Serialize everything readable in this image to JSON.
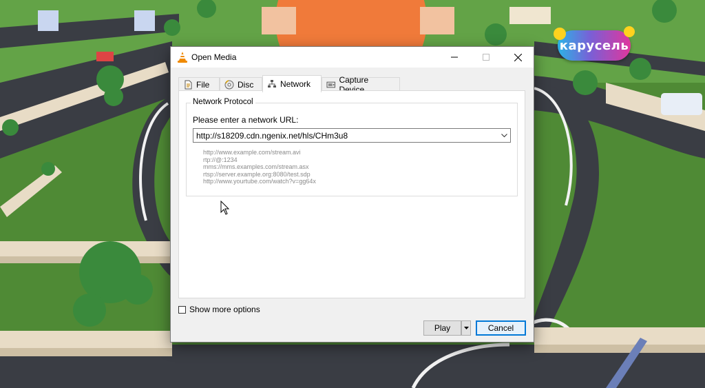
{
  "background": {
    "logo_text": "карусель"
  },
  "dialog": {
    "title": "Open Media",
    "window_buttons": {
      "minimize": "minimize-icon",
      "maximize": "maximize-icon",
      "close": "close-icon"
    },
    "tabs": [
      {
        "label": "File",
        "icon": "file-icon",
        "active": false
      },
      {
        "label": "Disc",
        "icon": "disc-icon",
        "active": false
      },
      {
        "label": "Network",
        "icon": "network-icon",
        "active": true
      },
      {
        "label": "Capture Device",
        "icon": "capture-device-icon",
        "active": false
      }
    ],
    "network": {
      "group_title": "Network Protocol",
      "url_label": "Please enter a network URL:",
      "url_value": "http://s18209.cdn.ngenix.net/hls/CHm3u8",
      "examples": [
        "http://www.example.com/stream.avi",
        "rtp://@:1234",
        "mms://mms.examples.com/stream.asx",
        "rtsp://server.example.org:8080/test.sdp",
        "http://www.yourtube.com/watch?v=gg64x"
      ]
    },
    "show_more_options": {
      "label": "Show more options",
      "checked": false
    },
    "buttons": {
      "play": "Play",
      "cancel": "Cancel"
    },
    "accent_color": "#0078d7"
  }
}
